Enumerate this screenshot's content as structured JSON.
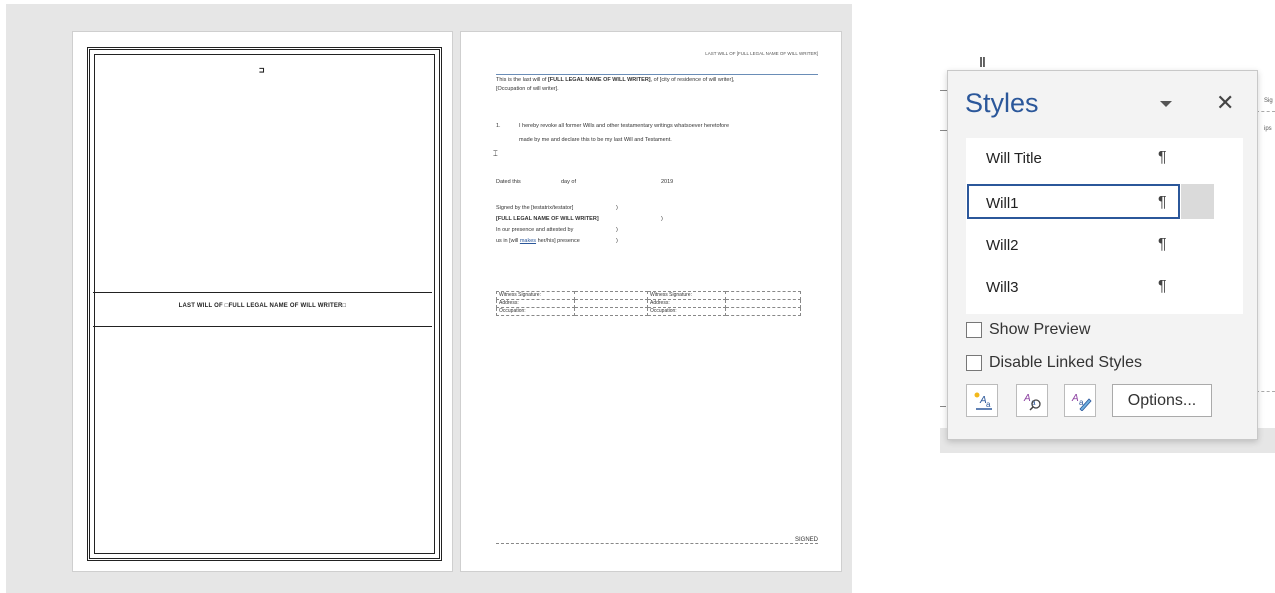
{
  "document": {
    "cover": {
      "title": "LAST WILL OF □FULL LEGAL NAME OF WILL WRITER□",
      "top_mark": "⊐"
    },
    "page2": {
      "header": "LAST WILL OF [FULL LEGAL NAME OF WILL WRITER]",
      "intro_line1_prefix": "This is the last will of ",
      "intro_line1_bold": "[FULL LEGAL NAME OF WILL WRITER]",
      "intro_line1_suffix": ", of [city of residence of will writer],",
      "intro_line2": "[Occupation of will writer].",
      "clause_number": "1.",
      "clause_line1": "I hereby revoke all former Wills and other testamentary writings whatsoever heretofore",
      "clause_line2": "made by me and declare this to be my last Will and Testament.",
      "dated_label": "Dated this",
      "day_of": "day of",
      "year": "2019",
      "signed_line": "Signed by the [testatrix/testator]",
      "signed_bold": "[FULL LEGAL NAME OF WILL WRITER]",
      "presence_line1": "In our presence and attested by",
      "presence_line2_a": "us in [will ",
      "presence_line2_link": "makes",
      "presence_line2_b": " her/his] presence",
      "paren": ")",
      "table": {
        "rows": [
          [
            "Witness Signature:",
            "",
            "Witness Signature:",
            ""
          ],
          [
            "Address:",
            "",
            "Address:",
            ""
          ],
          [
            "Occupation:",
            "",
            "Occupation:",
            ""
          ]
        ]
      },
      "footer_label": "SIGNED"
    }
  },
  "styles_pane": {
    "title": "Styles",
    "close_glyph": "✕",
    "styles": [
      {
        "label": "Will Title",
        "mark": "¶"
      },
      {
        "label": "Will1",
        "mark": "¶"
      },
      {
        "label": "Will2",
        "mark": "¶"
      },
      {
        "label": "Will3",
        "mark": "¶"
      }
    ],
    "selected_style": "Will1",
    "show_preview_label": "Show Preview",
    "disable_linked_label": "Disable Linked Styles",
    "options_label": "Options...",
    "accent_color": "#2b579a"
  },
  "background": {
    "tiny_text_1": "Sig",
    "tiny_text_2": "ips"
  }
}
